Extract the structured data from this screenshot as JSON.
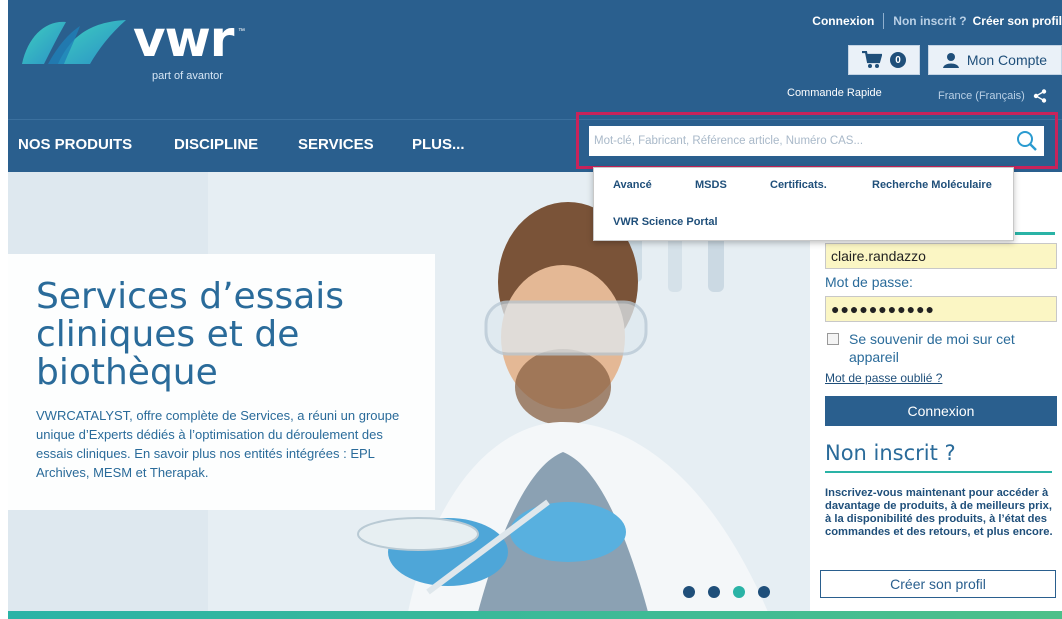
{
  "header": {
    "logo_word": "vwr",
    "logo_tm": "™",
    "logo_sub": "part of avantor",
    "connexion": "Connexion",
    "not_registered": "Non inscrit ?",
    "create_profile": "Créer son profil",
    "cart_count": "0",
    "account_label": "Mon Compte",
    "quick_order": "Commande Rapide",
    "locale": "France (Français)"
  },
  "nav": {
    "items": [
      "NOS PRODUITS",
      "DISCIPLINE",
      "SERVICES",
      "PLUS..."
    ]
  },
  "search": {
    "placeholder": "Mot-clé, Fabricant, Référence article, Numéro CAS...",
    "dropdown": [
      "Avancé",
      "MSDS",
      "Certificats.",
      "Recherche Moléculaire",
      "VWR Science Portal"
    ]
  },
  "hero": {
    "title": "Services d’essais cliniques et de biothèque",
    "text": "VWRCATALYST, offre complète de Services, a réuni un groupe unique d’Experts dédiés à l’optimisation du déroulement des essais cliniques. En savoir plus nos entités intégrées : EPL Archives, MESM et Therapak.",
    "slides": 4,
    "active_slide": 3
  },
  "login": {
    "username": "claire.randazzo",
    "password_label": "Mot de passe:",
    "password_mask": "●●●●●●●●●●●",
    "remember": "Se souvenir de moi sur cet appareil",
    "forgot": "Mot de passe oublié ?",
    "submit": "Connexion",
    "register_title": "Non inscrit ?",
    "register_text": "Inscrivez-vous maintenant pour accéder à davantage de produits, à de meilleurs prix, à la disponibilité des produits, à l’état des commandes et des retours, et plus encore.",
    "create_button": "Créer son profil"
  },
  "colors": {
    "header_blue": "#2a5f8e",
    "accent_teal": "#2ab3a6",
    "highlight_border": "#c8235a",
    "text_blue": "#2a6b9a"
  }
}
